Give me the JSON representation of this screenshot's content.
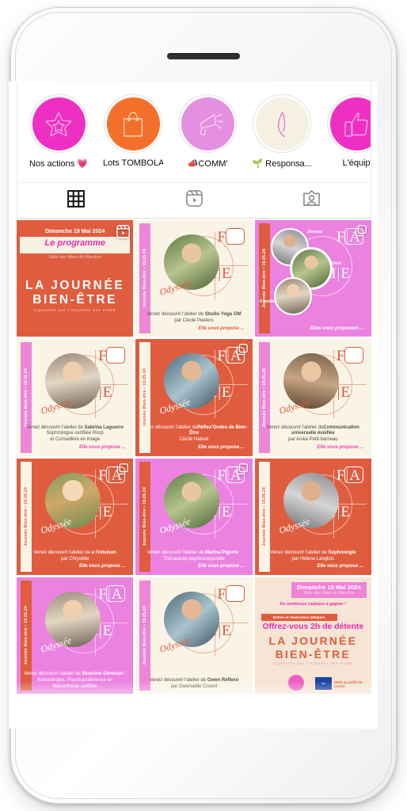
{
  "device": {
    "speaker_name": "earpiece-speaker"
  },
  "highlights": [
    {
      "label": "Nos actions 💗",
      "icon": "star-outline-icon",
      "bg": "#ee2fc3",
      "stroke": "#f9a8e0"
    },
    {
      "label": "Lots TOMBOLA",
      "icon": "shopping-bag-icon",
      "bg": "#f4702a",
      "stroke": "#fcd0b4"
    },
    {
      "label": "📣COMM'",
      "icon": "megaphone-icon",
      "bg": "#e58fe0",
      "stroke": "#f6cdf2"
    },
    {
      "label": "🌱 Responsa...",
      "icon": "leaf-icon",
      "bg": "#f6f0e3",
      "stroke": "#e27cc8"
    },
    {
      "label": "L'équip",
      "icon": "thumbs-up-icon",
      "bg": "#ee2fc3",
      "stroke": "#f9a8e0"
    }
  ],
  "tabs": [
    {
      "name": "grid-tab",
      "icon": "grid-icon",
      "active": true
    },
    {
      "name": "reels-tab",
      "icon": "reels-icon",
      "active": false
    },
    {
      "name": "tagged-tab",
      "icon": "tagged-person-icon",
      "active": false
    }
  ],
  "posts": [
    {
      "kind": "poster1",
      "badge": "reels-icon",
      "date": "Dimanche 19 Mai 2024",
      "programme": "Le programme",
      "venue": "Salle des fêtes de Marolles",
      "title_line1": "LA JOURNÉE",
      "title_line2": "BIEN-ÊTRE",
      "organiser": "organisée par l'Odyssée des FAME"
    },
    {
      "kind": "workshop",
      "badge": "none",
      "bg": "#faf4e6",
      "strip_bg": "#ee86d8",
      "strip_text": "Journée Bien-être • 19.05.24",
      "text_color": "#555049",
      "accent": "#e05c3e",
      "ody_color": "#e05c3e",
      "caption_intro": "Venez découvrir l'atelier de ",
      "caption_bold": "Studio Yoga OM",
      "caption_line2": "par Cécile Peeters",
      "caption_line3": "",
      "proposes": "Elle vous propose ..."
    },
    {
      "kind": "people",
      "badge": "carousel-icon",
      "bg": "#eb82e0",
      "strip_bg": "#e05c3e",
      "strip_text": "Journée Bien-être • 19.05.24",
      "names": [
        "Jémina",
        "Chloé",
        "Camille"
      ],
      "proposes": "Elles vous proposent ...",
      "accent": "#ffffff"
    },
    {
      "kind": "workshop",
      "badge": "none",
      "bg": "#faf4e6",
      "strip_bg": "#ee86d8",
      "strip_text": "Journée Bien-être • 19.05.24",
      "text_color": "#555049",
      "accent": "#ee3fb8",
      "ody_color": "#e05c3e",
      "caption_intro": "Venez découvrir l'atelier de ",
      "caption_bold": "Sabrina Laguerre",
      "caption_line2": "Sophrologue certifiée Rncp",
      "caption_line3": "et Conseillère en image",
      "proposes": "Elle vous propose ..."
    },
    {
      "kind": "workshop",
      "badge": "carousel-icon",
      "bg": "#e05c3e",
      "strip_bg": "#faf4e6",
      "strip_text": "Journée Bien-être • 19.05.24",
      "strip_color": "#e05c3e",
      "text_color": "#ffffff",
      "accent": "#ffffff",
      "ody_color": "#ffffff",
      "logo_color": "#ffffff",
      "caption_intro": "Venez découvrir l'atelier de",
      "caption_bold": "Réflex'Ondes de Bien-Être",
      "caption_line2": "Cécile Nativel",
      "caption_line3": "",
      "proposes": "Elle vous propose ..."
    },
    {
      "kind": "workshop",
      "badge": "none",
      "bg": "#faf4e6",
      "strip_bg": "#ee86d8",
      "strip_text": "Journée Bien-être • 19.05.24",
      "text_color": "#555049",
      "accent": "#ee3fb8",
      "ody_color": "#e05c3e",
      "caption_intro": "Venez découvrir l'atelier de",
      "caption_bold": "Communication universelle éveillée",
      "caption_line2": "par Anika Petit-barneau",
      "caption_line3": "",
      "proposes": "Elle vous propose ..."
    },
    {
      "kind": "workshop",
      "badge": "carousel-icon",
      "bg": "#e05c3e",
      "strip_bg": "#faf4e6",
      "strip_text": "Journée Bien-être • 19.05.24",
      "strip_color": "#e05c3e",
      "text_color": "#ffffff",
      "accent": "#ffffff",
      "ody_color": "#ffffff",
      "logo_color": "#ffffff",
      "caption_intro": "Venez découvrir l'atelier de ",
      "caption_bold": "à l'intuison",
      "caption_line2": "par Chrystèle",
      "caption_line3": "",
      "proposes": "Elle vous propose ..."
    },
    {
      "kind": "workshop",
      "badge": "carousel-icon",
      "bg": "#eb82e0",
      "strip_bg": "#e05c3e",
      "strip_text": "Journée Bien-être • 19.05.24",
      "strip_color": "#ffffff",
      "text_color": "#ffffff",
      "accent": "#ffffff",
      "ody_color": "#ffffff",
      "logo_color": "#ffffff",
      "caption_intro": "Venez découvrir l'atelier de ",
      "caption_bold": "Marina Pigerre :",
      "caption_line2": "Thérapeute psychocorporelle",
      "caption_line3": "",
      "proposes": "Elle vous propose ..."
    },
    {
      "kind": "workshop",
      "badge": "none",
      "bg": "#e05c3e",
      "strip_bg": "#faf4e6",
      "strip_text": "Journée Bien-être • 19.05.24",
      "strip_color": "#e05c3e",
      "text_color": "#ffffff",
      "accent": "#ffffff",
      "ody_color": "#ffffff",
      "logo_color": "#ffffff",
      "caption_intro": "Venez découvrir l'atelier de ",
      "caption_bold": "Sophrologie",
      "caption_line2": "par Hélène Langlois",
      "caption_line3": "",
      "proposes": "Elle vous propose ..."
    },
    {
      "kind": "workshop",
      "badge": "none",
      "bg": "#eb82e0",
      "strip_bg": "#e05c3e",
      "strip_text": "Journée Bien-être • 19.05.24",
      "strip_color": "#ffffff",
      "text_color": "#ffffff",
      "accent": "#ffffff",
      "ody_color": "#ffffff",
      "logo_color": "#ffffff",
      "caption_intro": "Venez découvrir l'atelier de ",
      "caption_bold": "Séverine Génisset :",
      "caption_line2": "Kinésiologue, Psychopraticienne en",
      "caption_line3": "Massothésie certifiée",
      "proposes": ""
    },
    {
      "kind": "workshop",
      "badge": "none",
      "bg": "#faf4e6",
      "strip_bg": "#ee86d8",
      "strip_text": "Journée Bien-être • 19.05.24",
      "text_color": "#555049",
      "accent": "#e05c3e",
      "ody_color": "#e05c3e",
      "caption_intro": "Venez découvrir l'atelier de ",
      "caption_bold": "Gwen Réflexo",
      "caption_line2": "par Gwenaëlle Couret",
      "caption_line3": "",
      "proposes": ""
    },
    {
      "kind": "poster2",
      "badge": "none",
      "date": "Dimanche 19 Mai 2024",
      "venue": "Salle des fêtes de Marolles",
      "gifts": "De nombreux cadeaux à gagner !",
      "entry": "Entrée et réservation 25€/pers",
      "offer": "Offrez-vous 2h de détente",
      "title_line1": "LA JOURNÉE",
      "title_line2": "BIEN-ÊTRE",
      "organiser": "organisée par l'Odyssée des FAME",
      "sponsor": "cic",
      "profit": "100% au profit du comité"
    }
  ],
  "logo": {
    "f": "F",
    "bar": "|",
    "a": "A",
    "m": "M",
    "e": "E",
    "ody": "Odyssée"
  }
}
